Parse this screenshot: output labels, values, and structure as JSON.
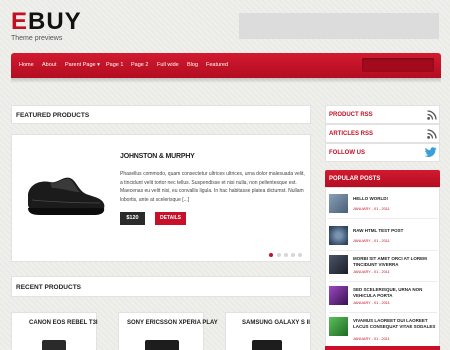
{
  "header": {
    "logo_first": "E",
    "logo_rest": "BUY",
    "tagline": "Theme previews"
  },
  "nav": {
    "items": [
      "Home",
      "About",
      "Parent Page ▾",
      "Page 1",
      "Page 2",
      "Full wide",
      "Blog",
      "Featured"
    ]
  },
  "featured": {
    "heading": "FEATURED PRODUCTS",
    "product_name": "JOHNSTON & MURPHY",
    "description": "Phasellus commodo, quam consectetur ultrices ultrices, urna dolor malesuada velit, a tincidunt velit tortor nec tellus. Suspendisse et nisi nulla, non pellentesque est. Maecenas eu velit nisi, eu convallis ligula. In hac habitasse platea dictumst. Nullam lobortis, ante at scelerisque [...]",
    "price": "$120",
    "details_label": "DETAILS",
    "active_slide": 1,
    "slide_count": 5
  },
  "recent": {
    "heading": "RECENT PRODUCTS",
    "items": [
      "CANON EOS REBEL T3I",
      "SONY ERICSSON XPERIA PLAY",
      "SAMSUNG GALAXY S II"
    ]
  },
  "sidebar": {
    "product_rss": "PRODUCT RSS",
    "articles_rss": "ARTICLES RSS",
    "follow_us": "FOLLOW US",
    "popular_heading": "POPULAR POSTS",
    "posts": [
      {
        "title": "HELLO WORLD!",
        "date": "JANUARY - 01 - 2011",
        "thumb_color": "#5b6f86"
      },
      {
        "title": "RAW HTML TEST POST",
        "date": "JANUARY - 01 - 2011",
        "thumb_color": "#3f5873"
      },
      {
        "title": "MORBI SIT AMET ORCI AT LOREM TINCIDUNT VIVERRA",
        "date": "JANUARY - 01 - 2011",
        "thumb_color": "#2b2f3a"
      },
      {
        "title": "SED SCELERISQUE, URNA NON VEHICULA PORTA",
        "date": "JANUARY - 01 - 2011",
        "thumb_color": "#6b2a8a"
      },
      {
        "title": "VIVAMUS LAOREET DUI LAOREET LACUS CONSEQUAT VITAE SODALES",
        "date": "JANUARY - 01 - 2011",
        "thumb_color": "#2f8a3c"
      }
    ]
  },
  "colors": {
    "brand_red": "#c8102a",
    "twitter_blue": "#3aa0d8"
  }
}
